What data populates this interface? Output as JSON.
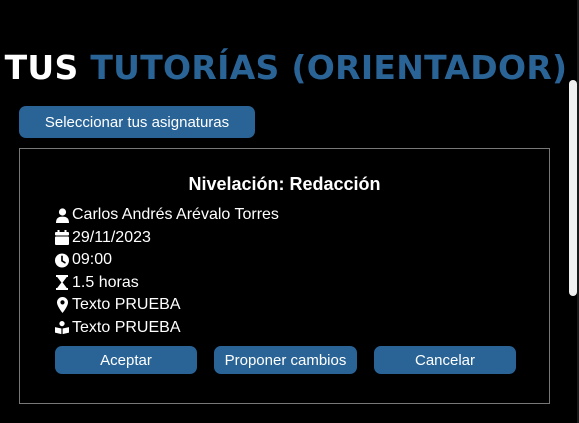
{
  "header": {
    "title_part1": "TUS",
    "title_part2": "TUTORÍAS (ORIENTADOR)"
  },
  "subjects_button": {
    "label": "Seleccionar tus asignaturas"
  },
  "tutoria": {
    "title": "Nivelación: Redacción",
    "details": [
      {
        "icon": "user-icon",
        "text": "Carlos Andrés Arévalo Torres"
      },
      {
        "icon": "calendar-icon",
        "text": "29/11/2023"
      },
      {
        "icon": "clock-icon",
        "text": "09:00"
      },
      {
        "icon": "hourglass-icon",
        "text": "1.5 horas"
      },
      {
        "icon": "map-marker-icon",
        "text": "Texto PRUEBA"
      },
      {
        "icon": "book-reader-icon",
        "text": "Texto PRUEBA"
      }
    ],
    "actions": {
      "accept": "Aceptar",
      "propose": "Proponer cambios",
      "cancel": "Cancelar"
    }
  },
  "colors": {
    "background": "#000000",
    "accent": "#2a6496",
    "text": "#ffffff",
    "card_border": "#777777"
  }
}
